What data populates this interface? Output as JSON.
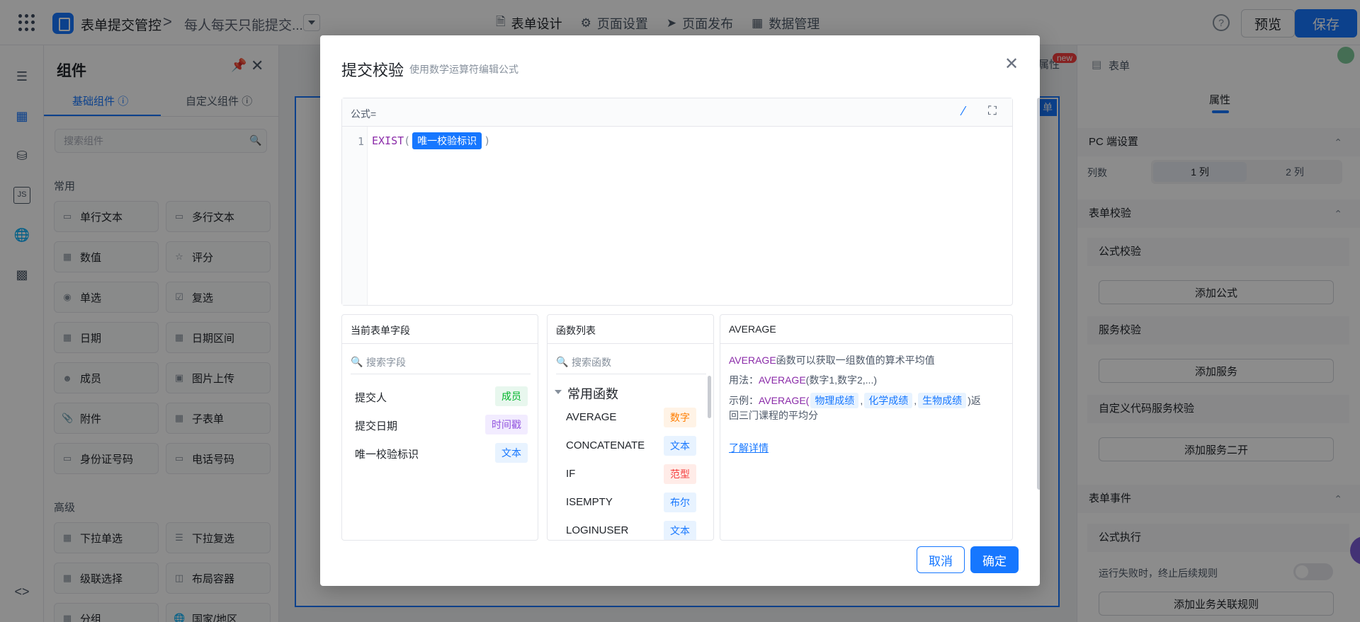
{
  "topbar": {
    "app_title": "表单提交管控",
    "breadcrumb_sep": ">",
    "form_title": "每人每天只能提交...",
    "tabs": [
      {
        "label": "表单设计",
        "icon": "document-icon"
      },
      {
        "label": "页面设置",
        "icon": "gear-icon"
      },
      {
        "label": "页面发布",
        "icon": "send-icon"
      },
      {
        "label": "数据管理",
        "icon": "table-icon"
      }
    ],
    "help": "?",
    "preview_label": "预览",
    "save_label": "保存"
  },
  "components": {
    "title": "组件",
    "tabs": [
      "基础组件",
      "自定义组件"
    ],
    "search_placeholder": "搜索组件",
    "common_title": "常用",
    "common": [
      "单行文本",
      "多行文本",
      "数值",
      "评分",
      "单选",
      "复选",
      "日期",
      "日期区间",
      "成员",
      "图片上传",
      "附件",
      "子表单",
      "身份证号码",
      "电话号码"
    ],
    "advanced_title": "高级",
    "advanced": [
      "下拉单选",
      "下拉复选",
      "级联选择",
      "布局容器",
      "分组",
      "国家/地区"
    ]
  },
  "canvas": {
    "prop_tab": "属性",
    "new_badge": "new",
    "tag": "单"
  },
  "props": {
    "head_label": "表单",
    "tab": "属性",
    "pc_section": "PC 端设置",
    "columns_label": "列数",
    "columns_options": [
      "1 列",
      "2 列"
    ],
    "validation_section": "表单校验",
    "formula_validation": "公式校验",
    "add_formula": "添加公式",
    "service_validation": "服务校验",
    "add_service": "添加服务",
    "custom_code_validation": "自定义代码服务校验",
    "add_service_dev": "添加服务二开",
    "events_section": "表单事件",
    "formula_exec": "公式执行",
    "fail_stop": "运行失败时，终止后续规则",
    "add_biz_rule": "添加业务关联规则"
  },
  "modal": {
    "title": "提交校验",
    "subtitle": "使用数学运算符编辑公式",
    "editor_label": "公式=",
    "line_number": "1",
    "code_fn": "EXIST",
    "code_open": "(",
    "code_chip": "唯一校验标识",
    "code_close": ")",
    "fields_pane": {
      "title": "当前表单字段",
      "search_placeholder": "搜索字段",
      "rows": [
        {
          "name": "提交人",
          "type": "成员"
        },
        {
          "name": "提交日期",
          "type": "时间戳"
        },
        {
          "name": "唯一校验标识",
          "type": "文本"
        }
      ]
    },
    "functions_pane": {
      "title": "函数列表",
      "search_placeholder": "搜索函数",
      "group": "常用函数",
      "rows": [
        {
          "name": "AVERAGE",
          "type": "数字"
        },
        {
          "name": "CONCATENATE",
          "type": "文本"
        },
        {
          "name": "IF",
          "type": "范型"
        },
        {
          "name": "ISEMPTY",
          "type": "布尔"
        },
        {
          "name": "LOGINUSER",
          "type": "文本"
        }
      ]
    },
    "doc_pane": {
      "title": "AVERAGE",
      "desc_fn": "AVERAGE",
      "desc_text": "函数可以获取一组数值的算术平均值",
      "usage_label": "用法：",
      "usage_fn": "AVERAGE",
      "usage_args": "(数字1,数字2,...)",
      "example_label": "示例：",
      "example_fn": "AVERAGE(",
      "example_chips": [
        "物理成绩",
        "化学成绩",
        "生物成绩"
      ],
      "example_tail": ")返",
      "example_line2": "回三门课程的平均分",
      "link": "了解详情"
    },
    "cancel_label": "取消",
    "ok_label": "确定"
  },
  "colors": {
    "primary": "#1677ff",
    "function_purple": "#8a2aa8",
    "mask": "rgba(0,0,0,0.45)"
  }
}
